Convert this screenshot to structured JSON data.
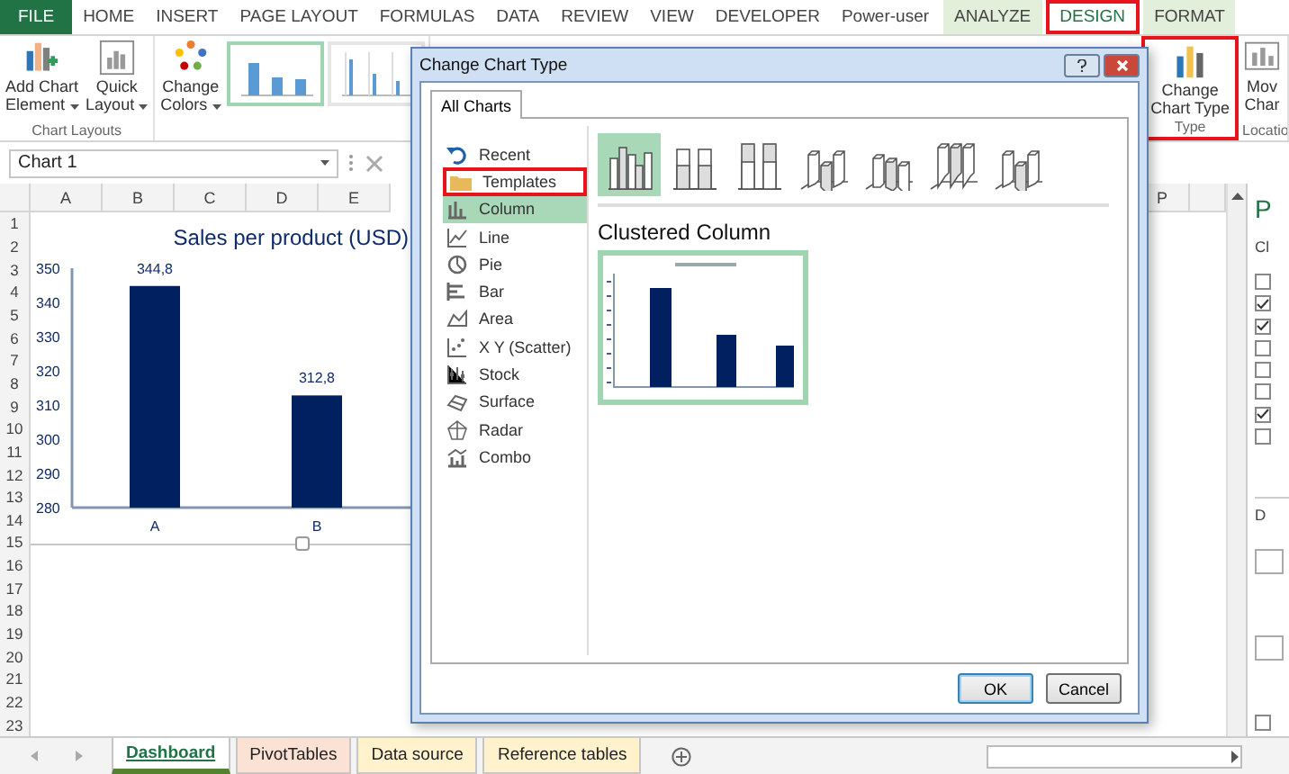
{
  "ribbon_tabs": [
    {
      "label": "FILE",
      "kind": "file",
      "selected": false,
      "highlighted": false
    },
    {
      "label": "HOME",
      "kind": "plain",
      "selected": false,
      "highlighted": false
    },
    {
      "label": "INSERT",
      "kind": "plain",
      "selected": false,
      "highlighted": false
    },
    {
      "label": "PAGE LAYOUT",
      "kind": "plain",
      "selected": false,
      "highlighted": false
    },
    {
      "label": "FORMULAS",
      "kind": "plain",
      "selected": false,
      "highlighted": false
    },
    {
      "label": "DATA",
      "kind": "plain",
      "selected": false,
      "highlighted": false
    },
    {
      "label": "REVIEW",
      "kind": "plain",
      "selected": false,
      "highlighted": false
    },
    {
      "label": "VIEW",
      "kind": "plain",
      "selected": false,
      "highlighted": false
    },
    {
      "label": "DEVELOPER",
      "kind": "plain",
      "selected": false,
      "highlighted": false
    },
    {
      "label": "Power-user",
      "kind": "plain",
      "selected": false,
      "highlighted": false
    },
    {
      "label": "ANALYZE",
      "kind": "context",
      "selected": false,
      "highlighted": false
    },
    {
      "label": "DESIGN",
      "kind": "context",
      "selected": true,
      "highlighted": true
    },
    {
      "label": "FORMAT",
      "kind": "context",
      "selected": false,
      "highlighted": false
    }
  ],
  "ribbon_left": [
    {
      "label": "Chart Layouts",
      "highlighted": false,
      "buttons": [
        {
          "lines": [
            "Add Chart",
            "Element"
          ],
          "kind": "add-chart",
          "dropdown": true
        },
        {
          "lines": [
            "Quick",
            "Layout"
          ],
          "kind": "quick-layout",
          "dropdown": true
        }
      ]
    },
    {
      "highlighted": false,
      "buttons": [
        {
          "lines": [
            "Change",
            "Colors"
          ],
          "kind": "colors",
          "dropdown": true
        }
      ],
      "styles": [
        {
          "selected": true
        },
        {
          "selected": false
        }
      ]
    }
  ],
  "ribbon_right": [
    {
      "label": "Type",
      "highlighted": true,
      "buttons": [
        {
          "lines": [
            "Change",
            "Chart Type"
          ],
          "kind": "chart-type",
          "dropdown": false
        }
      ]
    },
    {
      "label": "Locatio",
      "highlighted": false,
      "buttons": [
        {
          "lines": [
            "Mov",
            "Char"
          ],
          "kind": "move-chart",
          "dropdown": false
        }
      ]
    }
  ],
  "name_box": {
    "value": "Chart 1"
  },
  "sheet": {
    "columns": [
      "A",
      "B",
      "C",
      "D",
      "E",
      "P"
    ],
    "rows": [
      "1",
      "2",
      "3",
      "4",
      "5",
      "6",
      "7",
      "8",
      "9",
      "10",
      "11",
      "12",
      "13",
      "14",
      "15",
      "16",
      "17",
      "18",
      "19",
      "20",
      "21",
      "22",
      "23"
    ]
  },
  "chart": {
    "chart_data": {
      "type": "bar",
      "title": "Sales per product (USD)",
      "categories": [
        "A",
        "B"
      ],
      "values": [
        344.8,
        312.8
      ],
      "ylim": [
        280,
        350
      ],
      "yticks": [
        280,
        290,
        300,
        310,
        320,
        330,
        340,
        350
      ],
      "value_labels": [
        "344,8",
        "312,8"
      ]
    }
  },
  "side_pane": {
    "title": "P",
    "subtitle": "Cl",
    "options": [
      {
        "checked": false
      },
      {
        "checked": true
      },
      {
        "checked": true
      },
      {
        "checked": false
      },
      {
        "checked": false
      },
      {
        "checked": false
      },
      {
        "checked": true
      },
      {
        "checked": false
      }
    ],
    "section": "D",
    "footer_option": {
      "checked": false
    }
  },
  "sheet_tabs": [
    {
      "label": "Dashboard",
      "selected": true,
      "color": "#548235"
    },
    {
      "label": "PivotTables",
      "selected": false,
      "color": "#fbe2d5"
    },
    {
      "label": "Data source",
      "selected": false,
      "color": "#fff2cc"
    },
    {
      "label": "Reference tables",
      "selected": false,
      "color": "#fff2cc"
    }
  ],
  "dialog": {
    "title": "Change Chart Type",
    "tabs": [
      {
        "label": "All Charts",
        "selected": true
      }
    ],
    "chart_types": [
      {
        "label": "Recent",
        "kind": "recent",
        "selected": false,
        "highlighted": false
      },
      {
        "label": "Templates",
        "kind": "folder",
        "selected": false,
        "highlighted": true
      },
      {
        "label": "Column",
        "kind": "column",
        "selected": true,
        "highlighted": false
      },
      {
        "label": "Line",
        "kind": "line",
        "selected": false,
        "highlighted": false
      },
      {
        "label": "Pie",
        "kind": "pie",
        "selected": false,
        "highlighted": false
      },
      {
        "label": "Bar",
        "kind": "bar",
        "selected": false,
        "highlighted": false
      },
      {
        "label": "Area",
        "kind": "area",
        "selected": false,
        "highlighted": false
      },
      {
        "label": "X Y (Scatter)",
        "kind": "scatter",
        "selected": false,
        "highlighted": false
      },
      {
        "label": "Stock",
        "kind": "stock",
        "selected": false,
        "highlighted": false
      },
      {
        "label": "Surface",
        "kind": "surface",
        "selected": false,
        "highlighted": false
      },
      {
        "label": "Radar",
        "kind": "radar",
        "selected": false,
        "highlighted": false
      },
      {
        "label": "Combo",
        "kind": "combo",
        "selected": false,
        "highlighted": false
      }
    ],
    "subtypes": [
      {
        "kind": "clustered",
        "selected": true
      },
      {
        "kind": "stacked",
        "selected": false
      },
      {
        "kind": "full",
        "selected": false
      },
      {
        "kind": "clustered3d",
        "selected": false
      },
      {
        "kind": "stacked3d",
        "selected": false
      },
      {
        "kind": "full3d",
        "selected": false
      },
      {
        "kind": "column3d",
        "selected": false
      }
    ],
    "subtype_title": "Clustered Column",
    "buttons": [
      {
        "label": "OK",
        "default": true
      },
      {
        "label": "Cancel",
        "default": false
      }
    ]
  }
}
